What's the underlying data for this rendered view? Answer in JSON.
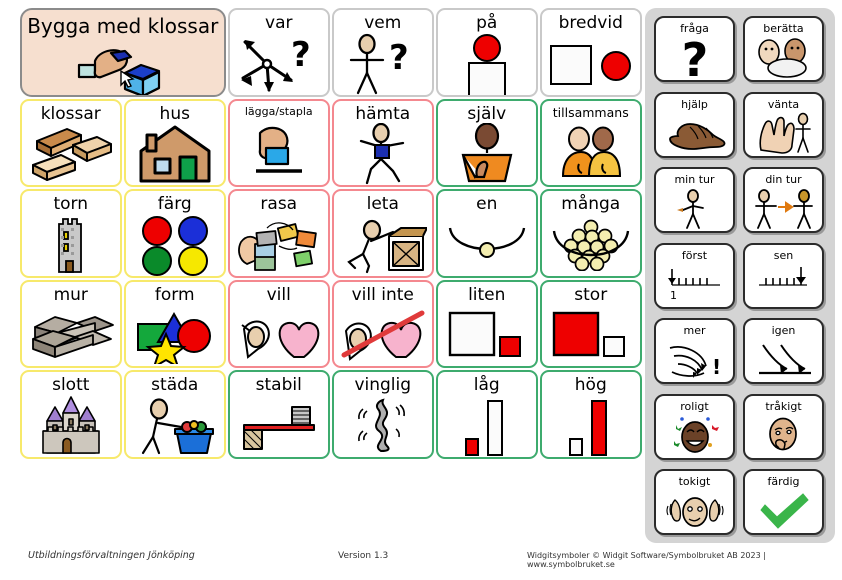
{
  "document": {
    "title": "Bygga med klossar",
    "footer_left": "Utbildningsförvaltningen Jönköping",
    "footer_center": "Version 1.3",
    "footer_right": "Widgitsymboler © Widgit Software/Symbolbruket AB 2023 | www.symbolbruket.se"
  },
  "colors": {
    "border_yellow": "#f7e96b",
    "border_red": "#f4888f",
    "border_green": "#3eab6e",
    "border_grey": "#d8d8d8",
    "title_bg": "#f6dfcf",
    "panel_bg": "#d4d4d4",
    "accent_red": "#ee0000",
    "accent_green": "#3ab54a",
    "accent_blue": "#1b4fd8"
  },
  "main_grid": {
    "rows": 6,
    "cols": 6,
    "cards": [
      {
        "id": "title",
        "label": "Bygga med klossar",
        "icon": "hand-placing-block-icon",
        "border": "title",
        "row": 0,
        "col": 0,
        "span": 2
      },
      {
        "id": "var",
        "label": "var",
        "icon": "arrows-question-icon",
        "border": "grey",
        "row": 0,
        "col": 2
      },
      {
        "id": "vem",
        "label": "vem",
        "icon": "person-question-icon",
        "border": "grey",
        "row": 0,
        "col": 3
      },
      {
        "id": "pa",
        "label": "på",
        "icon": "circle-on-square-icon",
        "border": "grey",
        "row": 0,
        "col": 4
      },
      {
        "id": "bredvid",
        "label": "bredvid",
        "icon": "square-beside-circle-icon",
        "border": "grey",
        "row": 0,
        "col": 5
      },
      {
        "id": "klossar",
        "label": "klossar",
        "icon": "wooden-blocks-icon",
        "border": "yellow",
        "row": 1,
        "col": 0
      },
      {
        "id": "hus",
        "label": "hus",
        "icon": "house-icon",
        "border": "yellow",
        "row": 1,
        "col": 1
      },
      {
        "id": "lagga",
        "label": "lägga/stapla",
        "icon": "hand-stacking-icon",
        "border": "red",
        "row": 1,
        "col": 2,
        "text_size": "smaller"
      },
      {
        "id": "hamta",
        "label": "hämta",
        "icon": "person-fetching-icon",
        "border": "red",
        "row": 1,
        "col": 3
      },
      {
        "id": "sjalv",
        "label": "själv",
        "icon": "person-self-icon",
        "border": "green",
        "row": 1,
        "col": 4
      },
      {
        "id": "tillsammans",
        "label": "tillsammans",
        "icon": "two-people-icon",
        "border": "green",
        "row": 1,
        "col": 5,
        "text_size": "small"
      },
      {
        "id": "torn",
        "label": "torn",
        "icon": "tower-icon",
        "border": "yellow",
        "row": 2,
        "col": 0
      },
      {
        "id": "farg",
        "label": "färg",
        "icon": "four-color-dots-icon",
        "border": "yellow",
        "row": 2,
        "col": 1
      },
      {
        "id": "rasa",
        "label": "rasa",
        "icon": "collapsing-blocks-icon",
        "border": "red",
        "row": 2,
        "col": 2
      },
      {
        "id": "leta",
        "label": "leta",
        "icon": "person-searching-box-icon",
        "border": "red",
        "row": 2,
        "col": 3
      },
      {
        "id": "en",
        "label": "en",
        "icon": "one-ball-bowl-icon",
        "border": "green",
        "row": 2,
        "col": 4
      },
      {
        "id": "manga",
        "label": "många",
        "icon": "many-balls-bowl-icon",
        "border": "green",
        "row": 2,
        "col": 5
      },
      {
        "id": "mur",
        "label": "mur",
        "icon": "stone-wall-icon",
        "border": "yellow",
        "row": 3,
        "col": 0
      },
      {
        "id": "form",
        "label": "form",
        "icon": "shapes-icon",
        "border": "yellow",
        "row": 3,
        "col": 1
      },
      {
        "id": "vill",
        "label": "vill",
        "icon": "want-heart-icon",
        "border": "red",
        "row": 3,
        "col": 2
      },
      {
        "id": "villinte",
        "label": "vill inte",
        "icon": "want-not-heart-icon",
        "border": "red",
        "row": 3,
        "col": 3
      },
      {
        "id": "liten",
        "label": "liten",
        "icon": "small-square-icon",
        "border": "green",
        "row": 3,
        "col": 4
      },
      {
        "id": "stor",
        "label": "stor",
        "icon": "big-square-icon",
        "border": "green",
        "row": 3,
        "col": 5
      },
      {
        "id": "slott",
        "label": "slott",
        "icon": "castle-icon",
        "border": "yellow",
        "row": 4,
        "col": 0
      },
      {
        "id": "stada",
        "label": "städa",
        "icon": "person-tidying-icon",
        "border": "yellow",
        "row": 4,
        "col": 1
      },
      {
        "id": "stabil",
        "label": "stabil",
        "icon": "stable-shelf-icon",
        "border": "green",
        "row": 4,
        "col": 2
      },
      {
        "id": "vinglig",
        "label": "vinglig",
        "icon": "wobbly-icon",
        "border": "green",
        "row": 4,
        "col": 3
      },
      {
        "id": "lag",
        "label": "låg",
        "icon": "low-bar-icon",
        "border": "green",
        "row": 4,
        "col": 4
      },
      {
        "id": "hog",
        "label": "hög",
        "icon": "high-bar-icon",
        "border": "green",
        "row": 4,
        "col": 5
      }
    ]
  },
  "side_panel": {
    "cards": [
      {
        "id": "fraga",
        "label": "fråga",
        "icon": "question-mark-icon",
        "row": 0,
        "col": 0
      },
      {
        "id": "beratta",
        "label": "berätta",
        "icon": "two-faces-speech-icon",
        "row": 0,
        "col": 1
      },
      {
        "id": "hjalp",
        "label": "hjälp",
        "icon": "helping-hand-icon",
        "row": 1,
        "col": 0
      },
      {
        "id": "vanta",
        "label": "vänta",
        "icon": "waiting-hand-person-icon",
        "row": 1,
        "col": 1
      },
      {
        "id": "minTur",
        "label": "min tur",
        "icon": "my-turn-person-icon",
        "row": 2,
        "col": 0
      },
      {
        "id": "dinTur",
        "label": "din tur",
        "icon": "your-turn-persons-icon",
        "row": 2,
        "col": 1
      },
      {
        "id": "forst",
        "label": "först",
        "icon": "first-ruler-icon",
        "row": 3,
        "col": 0
      },
      {
        "id": "sen",
        "label": "sen",
        "icon": "later-ruler-icon",
        "row": 3,
        "col": 1
      },
      {
        "id": "mer",
        "label": "mer",
        "icon": "more-swirl-icon",
        "row": 4,
        "col": 0
      },
      {
        "id": "igen",
        "label": "igen",
        "icon": "again-arrows-icon",
        "row": 4,
        "col": 1
      },
      {
        "id": "roligt",
        "label": "roligt",
        "icon": "happy-face-icon",
        "row": 5,
        "col": 0
      },
      {
        "id": "trakigt",
        "label": "tråkigt",
        "icon": "sad-face-icon",
        "row": 5,
        "col": 1
      },
      {
        "id": "tokigt",
        "label": "tokigt",
        "icon": "crazy-face-icon",
        "row": 6,
        "col": 0
      },
      {
        "id": "fardig",
        "label": "färdig",
        "icon": "green-check-icon",
        "row": 6,
        "col": 1
      }
    ],
    "ruler_first_number": "1"
  }
}
